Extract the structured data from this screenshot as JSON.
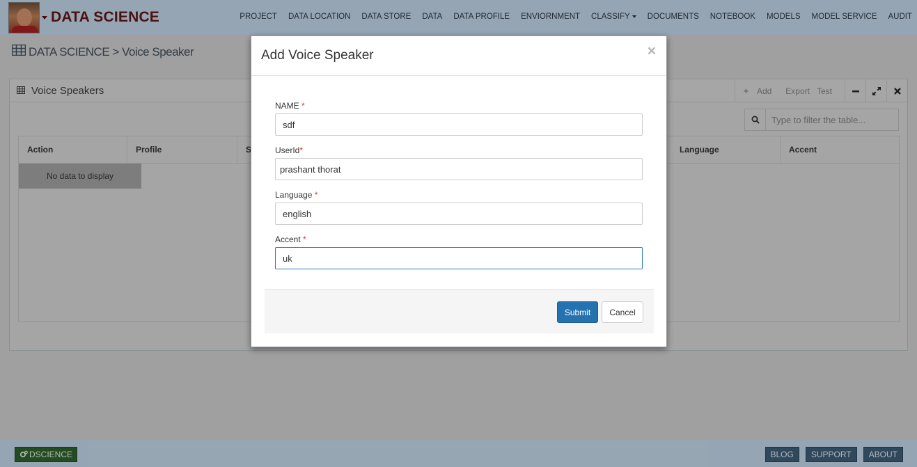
{
  "app": {
    "brand": "DATA SCIENCE",
    "nav": [
      "PROJECT",
      "DATA LOCATION",
      "DATA STORE",
      "DATA",
      "DATA PROFILE",
      "ENVIORNMENT",
      "CLASSIFY",
      "DOCUMENTS",
      "NOTEBOOK",
      "MODELS",
      "MODEL SERVICE",
      "AUDIT"
    ],
    "breadcrumb": "DATA SCIENCE > Voice Speaker"
  },
  "panel": {
    "title": "Voice Speakers",
    "tools": {
      "add": "Add",
      "export": "Export",
      "test": "Test"
    },
    "search_placeholder": "Type to filter the table...",
    "columns": {
      "action": "Action",
      "profile": "Profile",
      "s_partial": "S",
      "language": "Language",
      "accent": "Accent"
    },
    "empty_message": "No data to display"
  },
  "modal": {
    "title": "Add Voice Speaker",
    "close": "×",
    "fields": {
      "name": {
        "label": "NAME",
        "required": "*",
        "value": "sdf"
      },
      "userid": {
        "label": "UserId",
        "required": "*",
        "value": "prashant thorat"
      },
      "language": {
        "label": "Language",
        "required": "*",
        "value": "english"
      },
      "accent": {
        "label": "Accent",
        "required": "*",
        "value": "uk"
      }
    },
    "submit": "Submit",
    "cancel": "Cancel"
  },
  "footer": {
    "brand": "DSCIENCE",
    "links": [
      "BLOG",
      "SUPPORT",
      "ABOUT"
    ]
  },
  "colors": {
    "primary_button": "#2473b0",
    "brand_text": "#5e1515",
    "required_marker": "#d33"
  }
}
